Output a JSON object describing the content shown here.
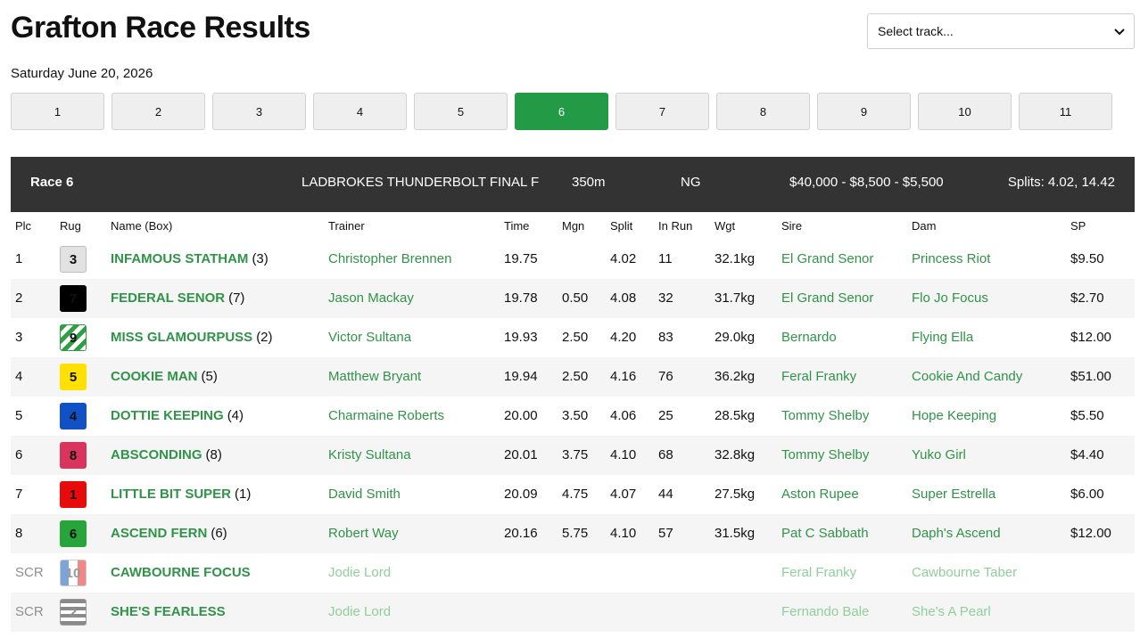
{
  "page": {
    "title": "Grafton Race Results",
    "date": "Saturday June 20, 2026"
  },
  "track_select": {
    "selected": "Select track..."
  },
  "race_tabs": [
    "1",
    "2",
    "3",
    "4",
    "5",
    "6",
    "7",
    "8",
    "9",
    "10",
    "11"
  ],
  "active_race": "6",
  "race": {
    "label": "Race 6",
    "name": "LADBROKES THUNDERBOLT FINAL F",
    "distance": "350m",
    "grade": "NG",
    "prizemoney": "$40,000 - $8,500 - $5,500",
    "splits": "Splits: 4.02, 14.42"
  },
  "columns": {
    "plc": "Plc",
    "rug": "Rug",
    "name": "Name (Box)",
    "trainer": "Trainer",
    "time": "Time",
    "mgn": "Mgn",
    "split": "Split",
    "inrun": "In Run",
    "wgt": "Wgt",
    "sire": "Sire",
    "dam": "Dam",
    "sp": "SP"
  },
  "runners": [
    {
      "plc": "1",
      "rug": "3",
      "name": "INFAMOUS STATHAM",
      "box": "(3)",
      "trainer": "Christopher Brennen",
      "time": "19.75",
      "mgn": "",
      "split": "4.02",
      "inrun": "11",
      "wgt": "32.1kg",
      "sire": "El Grand Senor",
      "dam": "Princess Riot",
      "sp": "$9.50",
      "scratched": false
    },
    {
      "plc": "2",
      "rug": "7",
      "name": "FEDERAL SENOR",
      "box": "(7)",
      "trainer": "Jason Mackay",
      "time": "19.78",
      "mgn": "0.50",
      "split": "4.08",
      "inrun": "32",
      "wgt": "31.7kg",
      "sire": "El Grand Senor",
      "dam": "Flo Jo Focus",
      "sp": "$2.70",
      "scratched": false
    },
    {
      "plc": "3",
      "rug": "9",
      "name": "MISS GLAMOURPUSS",
      "box": "(2)",
      "trainer": "Victor Sultana",
      "time": "19.93",
      "mgn": "2.50",
      "split": "4.20",
      "inrun": "83",
      "wgt": "29.0kg",
      "sire": "Bernardo",
      "dam": "Flying Ella",
      "sp": "$12.00",
      "scratched": false
    },
    {
      "plc": "4",
      "rug": "5",
      "name": "COOKIE MAN",
      "box": "(5)",
      "trainer": "Matthew Bryant",
      "time": "19.94",
      "mgn": "2.50",
      "split": "4.16",
      "inrun": "76",
      "wgt": "36.2kg",
      "sire": "Feral Franky",
      "dam": "Cookie And Candy",
      "sp": "$51.00",
      "scratched": false
    },
    {
      "plc": "5",
      "rug": "4",
      "name": "DOTTIE KEEPING",
      "box": "(4)",
      "trainer": "Charmaine Roberts",
      "time": "20.00",
      "mgn": "3.50",
      "split": "4.06",
      "inrun": "25",
      "wgt": "28.5kg",
      "sire": "Tommy Shelby",
      "dam": "Hope Keeping",
      "sp": "$5.50",
      "scratched": false
    },
    {
      "plc": "6",
      "rug": "8",
      "name": "ABSCONDING",
      "box": "(8)",
      "trainer": "Kristy Sultana",
      "time": "20.01",
      "mgn": "3.75",
      "split": "4.10",
      "inrun": "68",
      "wgt": "32.8kg",
      "sire": "Tommy Shelby",
      "dam": "Yuko Girl",
      "sp": "$4.40",
      "scratched": false
    },
    {
      "plc": "7",
      "rug": "1",
      "name": "LITTLE BIT SUPER",
      "box": "(1)",
      "trainer": "David Smith",
      "time": "20.09",
      "mgn": "4.75",
      "split": "4.07",
      "inrun": "44",
      "wgt": "27.5kg",
      "sire": "Aston Rupee",
      "dam": "Super Estrella",
      "sp": "$6.00",
      "scratched": false
    },
    {
      "plc": "8",
      "rug": "6",
      "name": "ASCEND FERN",
      "box": "(6)",
      "trainer": "Robert Way",
      "time": "20.16",
      "mgn": "5.75",
      "split": "4.10",
      "inrun": "57",
      "wgt": "31.5kg",
      "sire": "Pat C Sabbath",
      "dam": "Daph's Ascend",
      "sp": "$12.00",
      "scratched": false
    },
    {
      "plc": "SCR",
      "rug": "10",
      "name": "CAWBOURNE FOCUS",
      "box": "",
      "trainer": "Jodie Lord",
      "time": "",
      "mgn": "",
      "split": "",
      "inrun": "",
      "wgt": "",
      "sire": "Feral Franky",
      "dam": "Cawbourne Taber",
      "sp": "",
      "scratched": true
    },
    {
      "plc": "SCR",
      "rug": "2",
      "name": "SHE'S FEARLESS",
      "box": "",
      "trainer": "Jodie Lord",
      "time": "",
      "mgn": "",
      "split": "",
      "inrun": "",
      "wgt": "",
      "sire": "Fernando Bale",
      "dam": "She's A Pearl",
      "sp": "",
      "scratched": true
    }
  ],
  "colors": {
    "accent_green": "#239a45",
    "link_green": "#2f9448",
    "header_bg": "#333333"
  },
  "icons": {
    "select_chevron": "chevron-down-icon"
  }
}
